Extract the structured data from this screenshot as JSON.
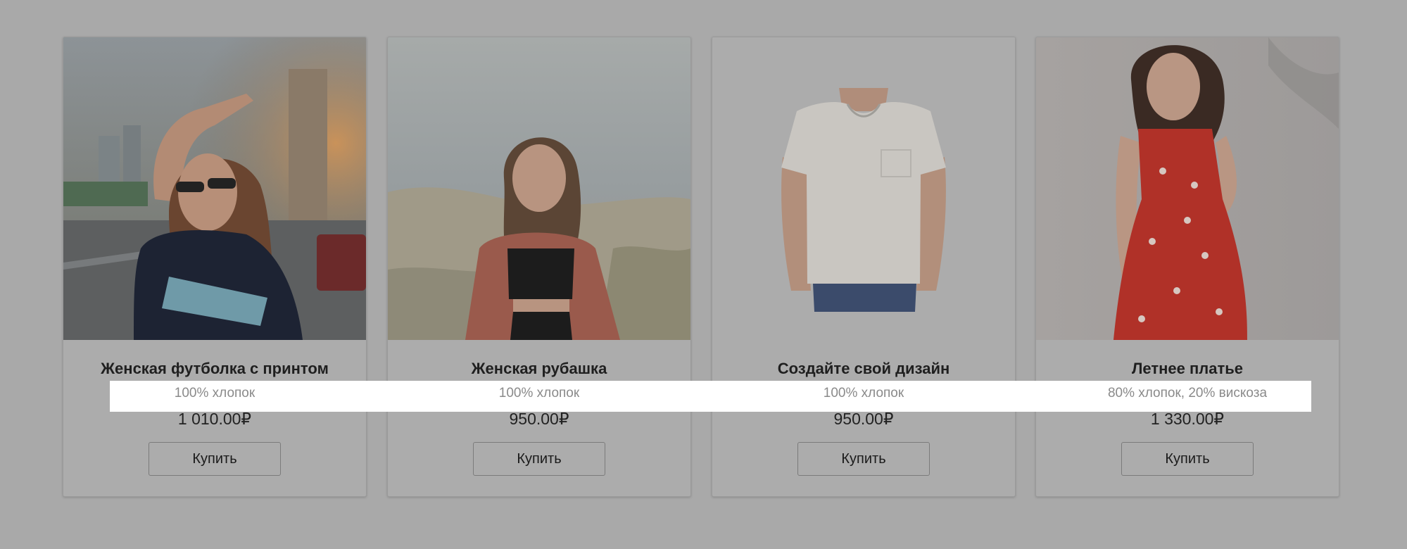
{
  "products": [
    {
      "title": "Женская футболка с принтом",
      "material": "100% хлопок",
      "price": "1 010.00₽",
      "button_label": "Купить",
      "image": "woman-with-sunglasses-photo"
    },
    {
      "title": "Женская рубашка",
      "material": "100% хлопок",
      "price": "950.00₽",
      "button_label": "Купить",
      "image": "woman-in-shirt-photo"
    },
    {
      "title": "Создайте свой дизайн",
      "material": "100% хлопок",
      "price": "950.00₽",
      "button_label": "Купить",
      "image": "white-tshirt-photo"
    },
    {
      "title": "Летнее платье",
      "material": "80% хлопок, 20% вискоза",
      "price": "1 330.00₽",
      "button_label": "Купить",
      "image": "red-dress-photo"
    }
  ],
  "colors": {
    "overlay": "#a9a9a9",
    "highlight": "#ffffff"
  }
}
